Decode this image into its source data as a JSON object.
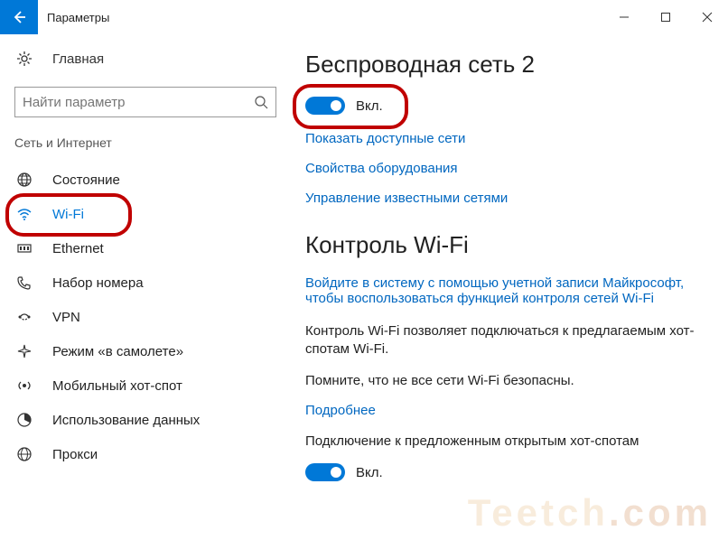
{
  "window": {
    "title": "Параметры"
  },
  "sidebar": {
    "home_label": "Главная",
    "search_placeholder": "Найти параметр",
    "category": "Сеть и Интернет",
    "items": [
      {
        "label": "Состояние"
      },
      {
        "label": "Wi-Fi"
      },
      {
        "label": "Ethernet"
      },
      {
        "label": "Набор номера"
      },
      {
        "label": "VPN"
      },
      {
        "label": "Режим «в самолете»"
      },
      {
        "label": "Мобильный хот-спот"
      },
      {
        "label": "Использование данных"
      },
      {
        "label": "Прокси"
      }
    ]
  },
  "main": {
    "heading1": "Беспроводная сеть 2",
    "wifi_toggle_label": "Вкл.",
    "link_show_networks": "Показать доступные сети",
    "link_hw_props": "Свойства оборудования",
    "link_manage_known": "Управление известными сетями",
    "heading2": "Контроль Wi-Fi",
    "link_ms_signin": "Войдите в систему с помощью учетной записи Майкрософт, чтобы воспользоваться функцией контроля сетей Wi-Fi",
    "text_desc": "Контроль Wi-Fi позволяет подключаться к предлагаемым хот-спотам Wi-Fi.",
    "text_warning": "Помните, что не все сети Wi-Fi безопасны.",
    "link_more": "Подробнее",
    "text_suggested": "Подключение к предложенным открытым хот-спотам",
    "suggested_toggle_label": "Вкл."
  },
  "watermark": "Teetch.com"
}
